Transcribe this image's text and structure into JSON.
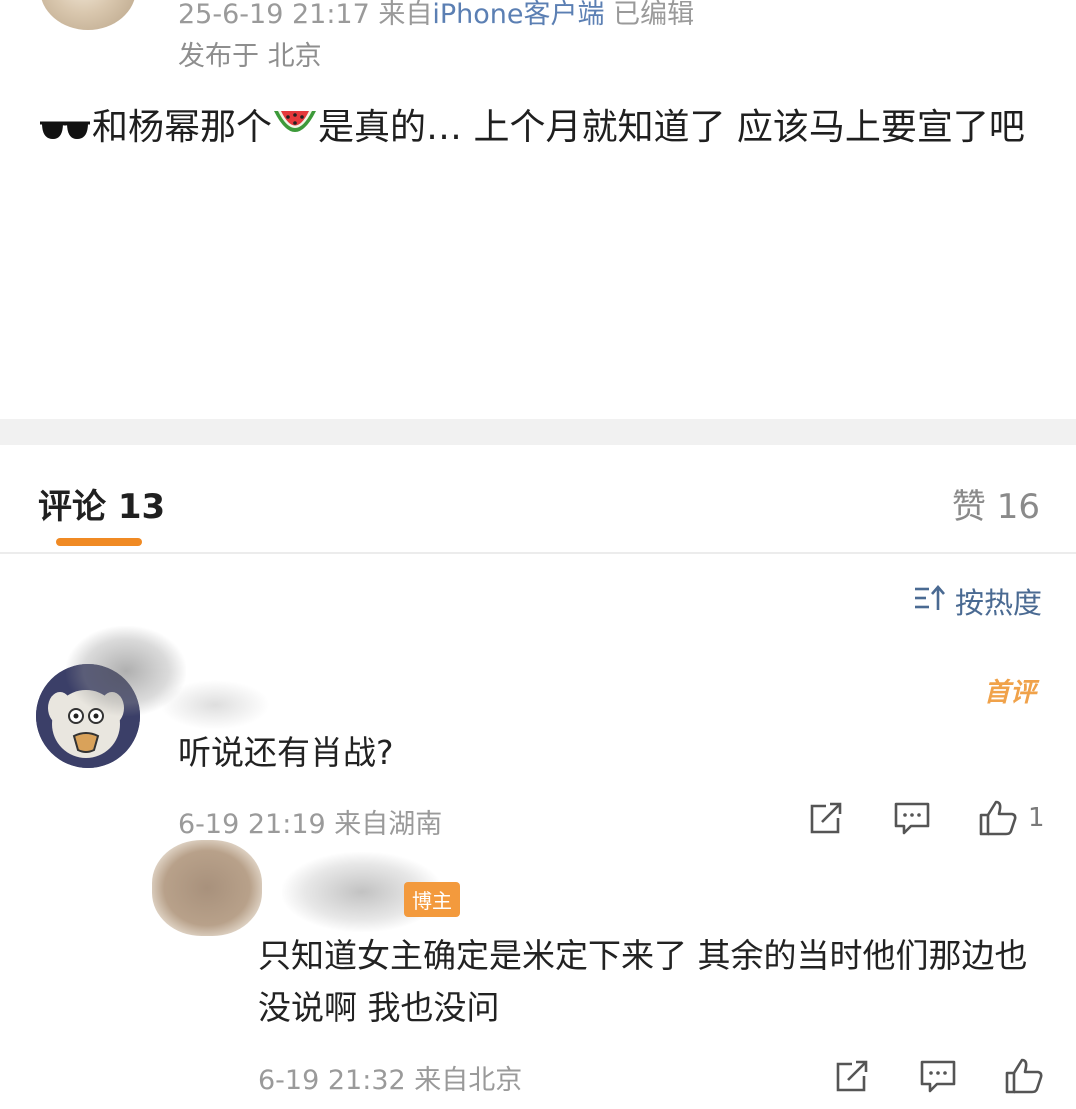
{
  "post": {
    "meta_time": "25-6-19 21:17",
    "meta_source_prefix": "来自",
    "meta_source": "iPhone客户端",
    "meta_edited": "已编辑",
    "location": "发布于 北京",
    "body_emoji_1": "sunglasses",
    "body_part_1": "和杨幂那个",
    "body_emoji_2": "watermelon",
    "body_part_2": "是真的… 上个月就知道了 应该马上要宣了吧"
  },
  "tabs": {
    "comments_label": "评论 13",
    "likes_label": "赞 16"
  },
  "sort": {
    "icon": "sort-icon",
    "label": "按热度"
  },
  "comments": [
    {
      "badge": "首评",
      "text": "听说还有肖战?",
      "time": "6-19 21:19  来自湖南",
      "like_count": "1",
      "actions": [
        "share-icon",
        "comment-icon",
        "like-icon"
      ]
    }
  ],
  "reply": {
    "badge": "博主",
    "text": "只知道女主确定是米定下来了  其余的当时他们那边也没说啊 我也没问",
    "time": "6-19 21:32  来自北京",
    "actions": [
      "share-icon",
      "comment-icon",
      "like-icon"
    ]
  },
  "colors": {
    "accent_orange": "#f08a24",
    "link_blue": "#5b7fb3",
    "sort_blue": "#4a6a92",
    "muted_text": "#9a9a9a",
    "badge_orange": "#f39a3d"
  }
}
